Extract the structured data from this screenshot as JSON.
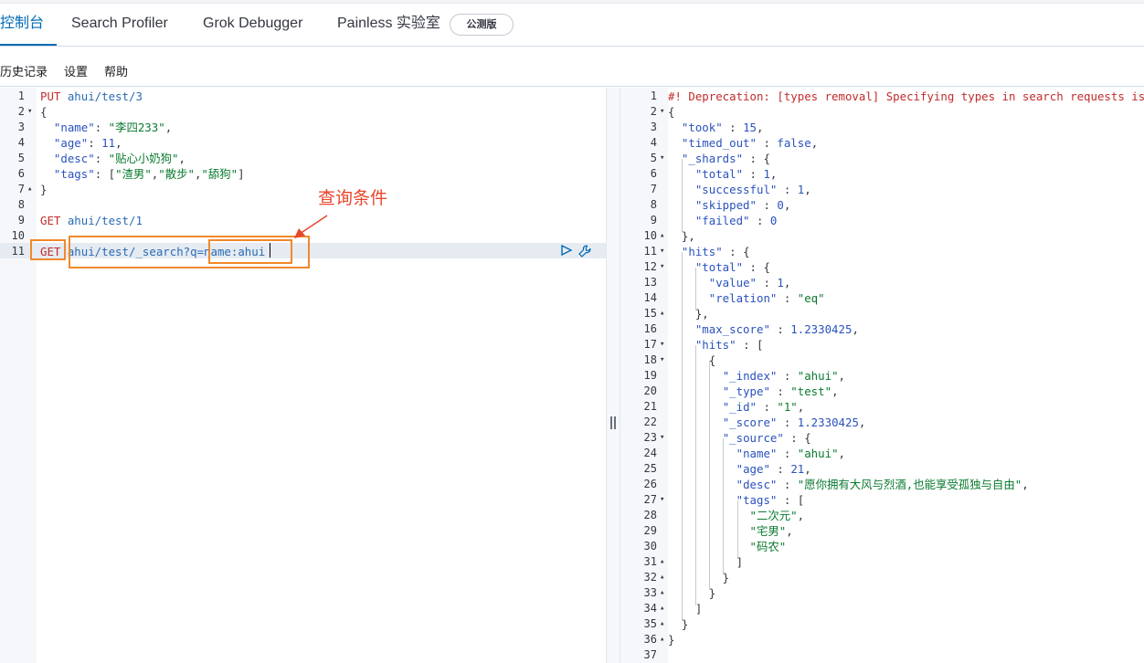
{
  "tabs": [
    {
      "label": "控制台",
      "active": true
    },
    {
      "label": "Search Profiler",
      "active": false
    },
    {
      "label": "Grok Debugger",
      "active": false
    },
    {
      "label": "Painless 实验室",
      "active": false
    }
  ],
  "beta_badge": "公测版",
  "menu": [
    "历史记录",
    "设置",
    "帮助"
  ],
  "annotation": "查询条件",
  "colors": {
    "accent": "#006bb4",
    "annotation": "#e8462b",
    "highlight_box": "#f0892b"
  },
  "request_editor": {
    "lines": [
      {
        "n": "1",
        "fold": "",
        "segs": [
          [
            "kw-method",
            "PUT "
          ],
          [
            "kw-url",
            "ahui/test/3"
          ]
        ]
      },
      {
        "n": "2",
        "fold": "▾",
        "segs": [
          [
            "kw-punc",
            "{"
          ]
        ]
      },
      {
        "n": "3",
        "fold": "",
        "segs": [
          [
            "kw-punc",
            "  "
          ],
          [
            "kw-key",
            "\"name\""
          ],
          [
            "kw-punc",
            ": "
          ],
          [
            "kw-str",
            "\"李四233\""
          ],
          [
            "kw-punc",
            ","
          ]
        ]
      },
      {
        "n": "4",
        "fold": "",
        "segs": [
          [
            "kw-punc",
            "  "
          ],
          [
            "kw-key",
            "\"age\""
          ],
          [
            "kw-punc",
            ": "
          ],
          [
            "kw-num",
            "11"
          ],
          [
            "kw-punc",
            ","
          ]
        ]
      },
      {
        "n": "5",
        "fold": "",
        "segs": [
          [
            "kw-punc",
            "  "
          ],
          [
            "kw-key",
            "\"desc\""
          ],
          [
            "kw-punc",
            ": "
          ],
          [
            "kw-str",
            "\"贴心小奶狗\""
          ],
          [
            "kw-punc",
            ","
          ]
        ]
      },
      {
        "n": "6",
        "fold": "",
        "segs": [
          [
            "kw-punc",
            "  "
          ],
          [
            "kw-key",
            "\"tags\""
          ],
          [
            "kw-punc",
            ": ["
          ],
          [
            "kw-str",
            "\"渣男\""
          ],
          [
            "kw-punc",
            ","
          ],
          [
            "kw-str",
            "\"散步\""
          ],
          [
            "kw-punc",
            ","
          ],
          [
            "kw-str",
            "\"舔狗\""
          ],
          [
            "kw-punc",
            "]"
          ]
        ]
      },
      {
        "n": "7",
        "fold": "▴",
        "segs": [
          [
            "kw-punc",
            "}"
          ]
        ]
      },
      {
        "n": "8",
        "fold": "",
        "segs": []
      },
      {
        "n": "9",
        "fold": "",
        "segs": [
          [
            "kw-method",
            "GET "
          ],
          [
            "kw-url",
            "ahui/test/1"
          ]
        ]
      },
      {
        "n": "10",
        "fold": "",
        "segs": []
      },
      {
        "n": "11",
        "fold": "",
        "segs": [
          [
            "kw-method",
            "GET "
          ],
          [
            "kw-url",
            "ahui/test/_search?q=name:ahui"
          ]
        ]
      }
    ]
  },
  "response_output": {
    "lines": [
      {
        "n": "1",
        "fold": "",
        "segs": [
          [
            "kw-warn",
            "#! Deprecation: [types removal] Specifying types in search requests is deprecated."
          ]
        ]
      },
      {
        "n": "2",
        "fold": "▾",
        "segs": [
          [
            "kw-punc",
            "{"
          ]
        ]
      },
      {
        "n": "3",
        "fold": "",
        "segs": [
          [
            "kw-punc",
            "  "
          ],
          [
            "kw-key",
            "\"took\""
          ],
          [
            "kw-punc",
            " : "
          ],
          [
            "kw-num",
            "15"
          ],
          [
            "kw-punc",
            ","
          ]
        ]
      },
      {
        "n": "4",
        "fold": "",
        "segs": [
          [
            "kw-punc",
            "  "
          ],
          [
            "kw-key",
            "\"timed_out\""
          ],
          [
            "kw-punc",
            " : "
          ],
          [
            "kw-bool",
            "false"
          ],
          [
            "kw-punc",
            ","
          ]
        ]
      },
      {
        "n": "5",
        "fold": "▾",
        "segs": [
          [
            "kw-punc",
            "  "
          ],
          [
            "kw-key",
            "\"_shards\""
          ],
          [
            "kw-punc",
            " : {"
          ]
        ]
      },
      {
        "n": "6",
        "fold": "",
        "segs": [
          [
            "kw-punc",
            "    "
          ],
          [
            "kw-key",
            "\"total\""
          ],
          [
            "kw-punc",
            " : "
          ],
          [
            "kw-num",
            "1"
          ],
          [
            "kw-punc",
            ","
          ]
        ]
      },
      {
        "n": "7",
        "fold": "",
        "segs": [
          [
            "kw-punc",
            "    "
          ],
          [
            "kw-key",
            "\"successful\""
          ],
          [
            "kw-punc",
            " : "
          ],
          [
            "kw-num",
            "1"
          ],
          [
            "kw-punc",
            ","
          ]
        ]
      },
      {
        "n": "8",
        "fold": "",
        "segs": [
          [
            "kw-punc",
            "    "
          ],
          [
            "kw-key",
            "\"skipped\""
          ],
          [
            "kw-punc",
            " : "
          ],
          [
            "kw-num",
            "0"
          ],
          [
            "kw-punc",
            ","
          ]
        ]
      },
      {
        "n": "9",
        "fold": "",
        "segs": [
          [
            "kw-punc",
            "    "
          ],
          [
            "kw-key",
            "\"failed\""
          ],
          [
            "kw-punc",
            " : "
          ],
          [
            "kw-num",
            "0"
          ]
        ]
      },
      {
        "n": "10",
        "fold": "▴",
        "segs": [
          [
            "kw-punc",
            "  },"
          ]
        ]
      },
      {
        "n": "11",
        "fold": "▾",
        "segs": [
          [
            "kw-punc",
            "  "
          ],
          [
            "kw-key",
            "\"hits\""
          ],
          [
            "kw-punc",
            " : {"
          ]
        ]
      },
      {
        "n": "12",
        "fold": "▾",
        "segs": [
          [
            "kw-punc",
            "    "
          ],
          [
            "kw-key",
            "\"total\""
          ],
          [
            "kw-punc",
            " : {"
          ]
        ]
      },
      {
        "n": "13",
        "fold": "",
        "segs": [
          [
            "kw-punc",
            "      "
          ],
          [
            "kw-key",
            "\"value\""
          ],
          [
            "kw-punc",
            " : "
          ],
          [
            "kw-num",
            "1"
          ],
          [
            "kw-punc",
            ","
          ]
        ]
      },
      {
        "n": "14",
        "fold": "",
        "segs": [
          [
            "kw-punc",
            "      "
          ],
          [
            "kw-key",
            "\"relation\""
          ],
          [
            "kw-punc",
            " : "
          ],
          [
            "kw-str",
            "\"eq\""
          ]
        ]
      },
      {
        "n": "15",
        "fold": "▴",
        "segs": [
          [
            "kw-punc",
            "    },"
          ]
        ]
      },
      {
        "n": "16",
        "fold": "",
        "segs": [
          [
            "kw-punc",
            "    "
          ],
          [
            "kw-key",
            "\"max_score\""
          ],
          [
            "kw-punc",
            " : "
          ],
          [
            "kw-num",
            "1.2330425"
          ],
          [
            "kw-punc",
            ","
          ]
        ]
      },
      {
        "n": "17",
        "fold": "▾",
        "segs": [
          [
            "kw-punc",
            "    "
          ],
          [
            "kw-key",
            "\"hits\""
          ],
          [
            "kw-punc",
            " : ["
          ]
        ]
      },
      {
        "n": "18",
        "fold": "▾",
        "segs": [
          [
            "kw-punc",
            "      {"
          ]
        ]
      },
      {
        "n": "19",
        "fold": "",
        "segs": [
          [
            "kw-punc",
            "        "
          ],
          [
            "kw-key",
            "\"_index\""
          ],
          [
            "kw-punc",
            " : "
          ],
          [
            "kw-str",
            "\"ahui\""
          ],
          [
            "kw-punc",
            ","
          ]
        ]
      },
      {
        "n": "20",
        "fold": "",
        "segs": [
          [
            "kw-punc",
            "        "
          ],
          [
            "kw-key",
            "\"_type\""
          ],
          [
            "kw-punc",
            " : "
          ],
          [
            "kw-str",
            "\"test\""
          ],
          [
            "kw-punc",
            ","
          ]
        ]
      },
      {
        "n": "21",
        "fold": "",
        "segs": [
          [
            "kw-punc",
            "        "
          ],
          [
            "kw-key",
            "\"_id\""
          ],
          [
            "kw-punc",
            " : "
          ],
          [
            "kw-str",
            "\"1\""
          ],
          [
            "kw-punc",
            ","
          ]
        ]
      },
      {
        "n": "22",
        "fold": "",
        "segs": [
          [
            "kw-punc",
            "        "
          ],
          [
            "kw-key",
            "\"_score\""
          ],
          [
            "kw-punc",
            " : "
          ],
          [
            "kw-num",
            "1.2330425"
          ],
          [
            "kw-punc",
            ","
          ]
        ]
      },
      {
        "n": "23",
        "fold": "▾",
        "segs": [
          [
            "kw-punc",
            "        "
          ],
          [
            "kw-key",
            "\"_source\""
          ],
          [
            "kw-punc",
            " : {"
          ]
        ]
      },
      {
        "n": "24",
        "fold": "",
        "segs": [
          [
            "kw-punc",
            "          "
          ],
          [
            "kw-key",
            "\"name\""
          ],
          [
            "kw-punc",
            " : "
          ],
          [
            "kw-str",
            "\"ahui\""
          ],
          [
            "kw-punc",
            ","
          ]
        ]
      },
      {
        "n": "25",
        "fold": "",
        "segs": [
          [
            "kw-punc",
            "          "
          ],
          [
            "kw-key",
            "\"age\""
          ],
          [
            "kw-punc",
            " : "
          ],
          [
            "kw-num",
            "21"
          ],
          [
            "kw-punc",
            ","
          ]
        ]
      },
      {
        "n": "26",
        "fold": "",
        "segs": [
          [
            "kw-punc",
            "          "
          ],
          [
            "kw-key",
            "\"desc\""
          ],
          [
            "kw-punc",
            " : "
          ],
          [
            "kw-str",
            "\"愿你拥有大风与烈酒,也能享受孤独与自由\""
          ],
          [
            "kw-punc",
            ","
          ]
        ]
      },
      {
        "n": "27",
        "fold": "▾",
        "segs": [
          [
            "kw-punc",
            "          "
          ],
          [
            "kw-key",
            "\"tags\""
          ],
          [
            "kw-punc",
            " : ["
          ]
        ]
      },
      {
        "n": "28",
        "fold": "",
        "segs": [
          [
            "kw-punc",
            "            "
          ],
          [
            "kw-str",
            "\"二次元\""
          ],
          [
            "kw-punc",
            ","
          ]
        ]
      },
      {
        "n": "29",
        "fold": "",
        "segs": [
          [
            "kw-punc",
            "            "
          ],
          [
            "kw-str",
            "\"宅男\""
          ],
          [
            "kw-punc",
            ","
          ]
        ]
      },
      {
        "n": "30",
        "fold": "",
        "segs": [
          [
            "kw-punc",
            "            "
          ],
          [
            "kw-str",
            "\"码农\""
          ]
        ]
      },
      {
        "n": "31",
        "fold": "▴",
        "segs": [
          [
            "kw-punc",
            "          ]"
          ]
        ]
      },
      {
        "n": "32",
        "fold": "▴",
        "segs": [
          [
            "kw-punc",
            "        }"
          ]
        ]
      },
      {
        "n": "33",
        "fold": "▴",
        "segs": [
          [
            "kw-punc",
            "      }"
          ]
        ]
      },
      {
        "n": "34",
        "fold": "▴",
        "segs": [
          [
            "kw-punc",
            "    ]"
          ]
        ]
      },
      {
        "n": "35",
        "fold": "▴",
        "segs": [
          [
            "kw-punc",
            "  }"
          ]
        ]
      },
      {
        "n": "36",
        "fold": "▴",
        "segs": [
          [
            "kw-punc",
            "}"
          ]
        ]
      },
      {
        "n": "37",
        "fold": "",
        "segs": []
      }
    ]
  }
}
